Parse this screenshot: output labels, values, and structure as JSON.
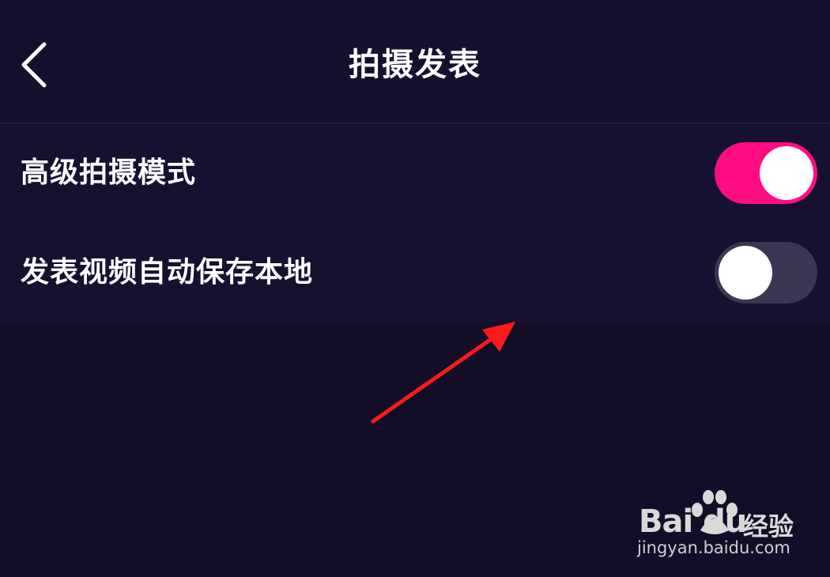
{
  "header": {
    "title": "拍摄发表",
    "back_icon": "chevron-left-icon"
  },
  "settings": [
    {
      "label": "高级拍摄模式",
      "enabled": true
    },
    {
      "label": "发表视频自动保存本地",
      "enabled": false
    }
  ],
  "colors": {
    "background": "#130e27",
    "panel": "#161131",
    "toggle_on": "#ff0d82",
    "toggle_off": "#3c3652",
    "annotation_arrow": "#ff1a1a"
  },
  "watermark": {
    "logo_text": "Bai du",
    "brand": "经验",
    "url": "jingyan.baidu.com"
  }
}
